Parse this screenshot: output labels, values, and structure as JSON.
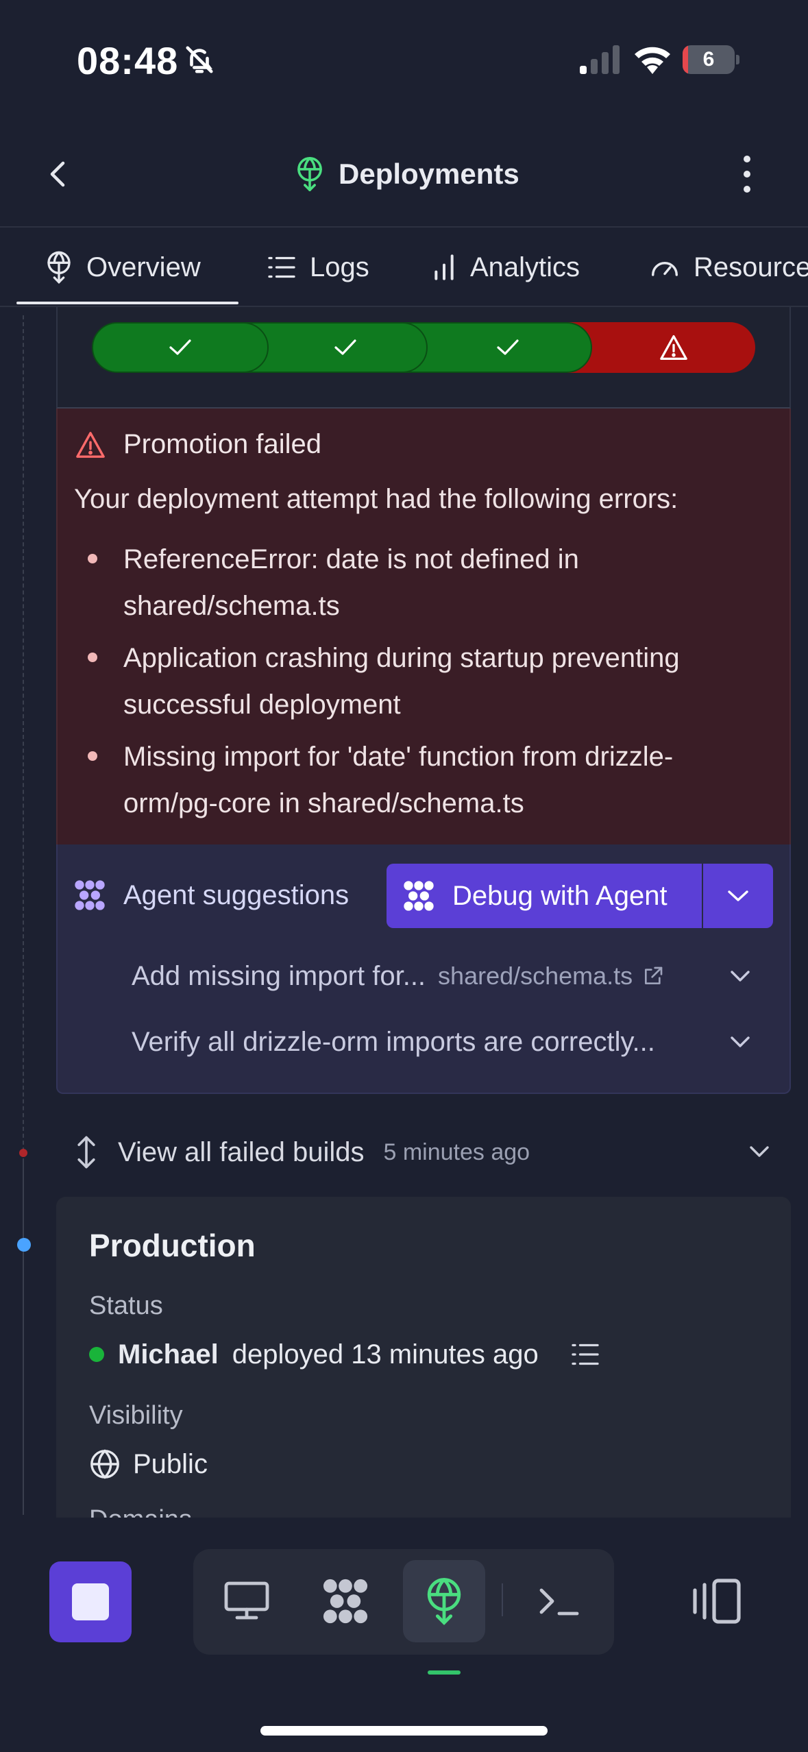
{
  "status_bar": {
    "time": "08:48",
    "battery": "6"
  },
  "header": {
    "title": "Deployments"
  },
  "tabs": [
    {
      "label": "Overview"
    },
    {
      "label": "Logs"
    },
    {
      "label": "Analytics"
    },
    {
      "label": "Resources"
    }
  ],
  "colors": {
    "accent": "#5b3fd6",
    "success": "#0f7a1f",
    "error": "#a8100f",
    "deploy_icon": "#4ade80"
  },
  "build": {
    "steps": [
      "success",
      "success",
      "success",
      "error"
    ],
    "error_title": "Promotion failed",
    "error_intro": "Your deployment attempt had the following errors:",
    "errors": [
      "ReferenceError: date is not defined in shared/schema.ts",
      "Application crashing during startup preventing successful deployment",
      "Missing import for 'date' function from drizzle-orm/pg-core in shared/schema.ts"
    ]
  },
  "agent": {
    "label": "Agent suggestions",
    "debug_button": "Debug with Agent",
    "suggestions": [
      {
        "text": "Add missing import for...",
        "file": "shared/schema.ts"
      },
      {
        "text": "Verify all drizzle-orm imports are correctly...",
        "file": ""
      }
    ]
  },
  "failed_builds": {
    "label": "View all failed builds",
    "time": "5 minutes ago"
  },
  "production": {
    "title": "Production",
    "status_label": "Status",
    "deployer": "Michael",
    "deployed_text": "deployed 13 minutes ago",
    "visibility_label": "Visibility",
    "visibility_value": "Public",
    "next_label": "Domains"
  },
  "icons": [
    "back-icon",
    "deploy-icon",
    "more-icon",
    "overview-icon",
    "logs-icon",
    "analytics-icon",
    "resources-icon",
    "check-icon",
    "warning-icon",
    "agent-icon",
    "chevron-down-icon",
    "external-link-icon",
    "expand-icon",
    "list-icon",
    "globe-icon",
    "stop-icon",
    "monitor-icon",
    "terminal-icon",
    "panel-icon"
  ]
}
